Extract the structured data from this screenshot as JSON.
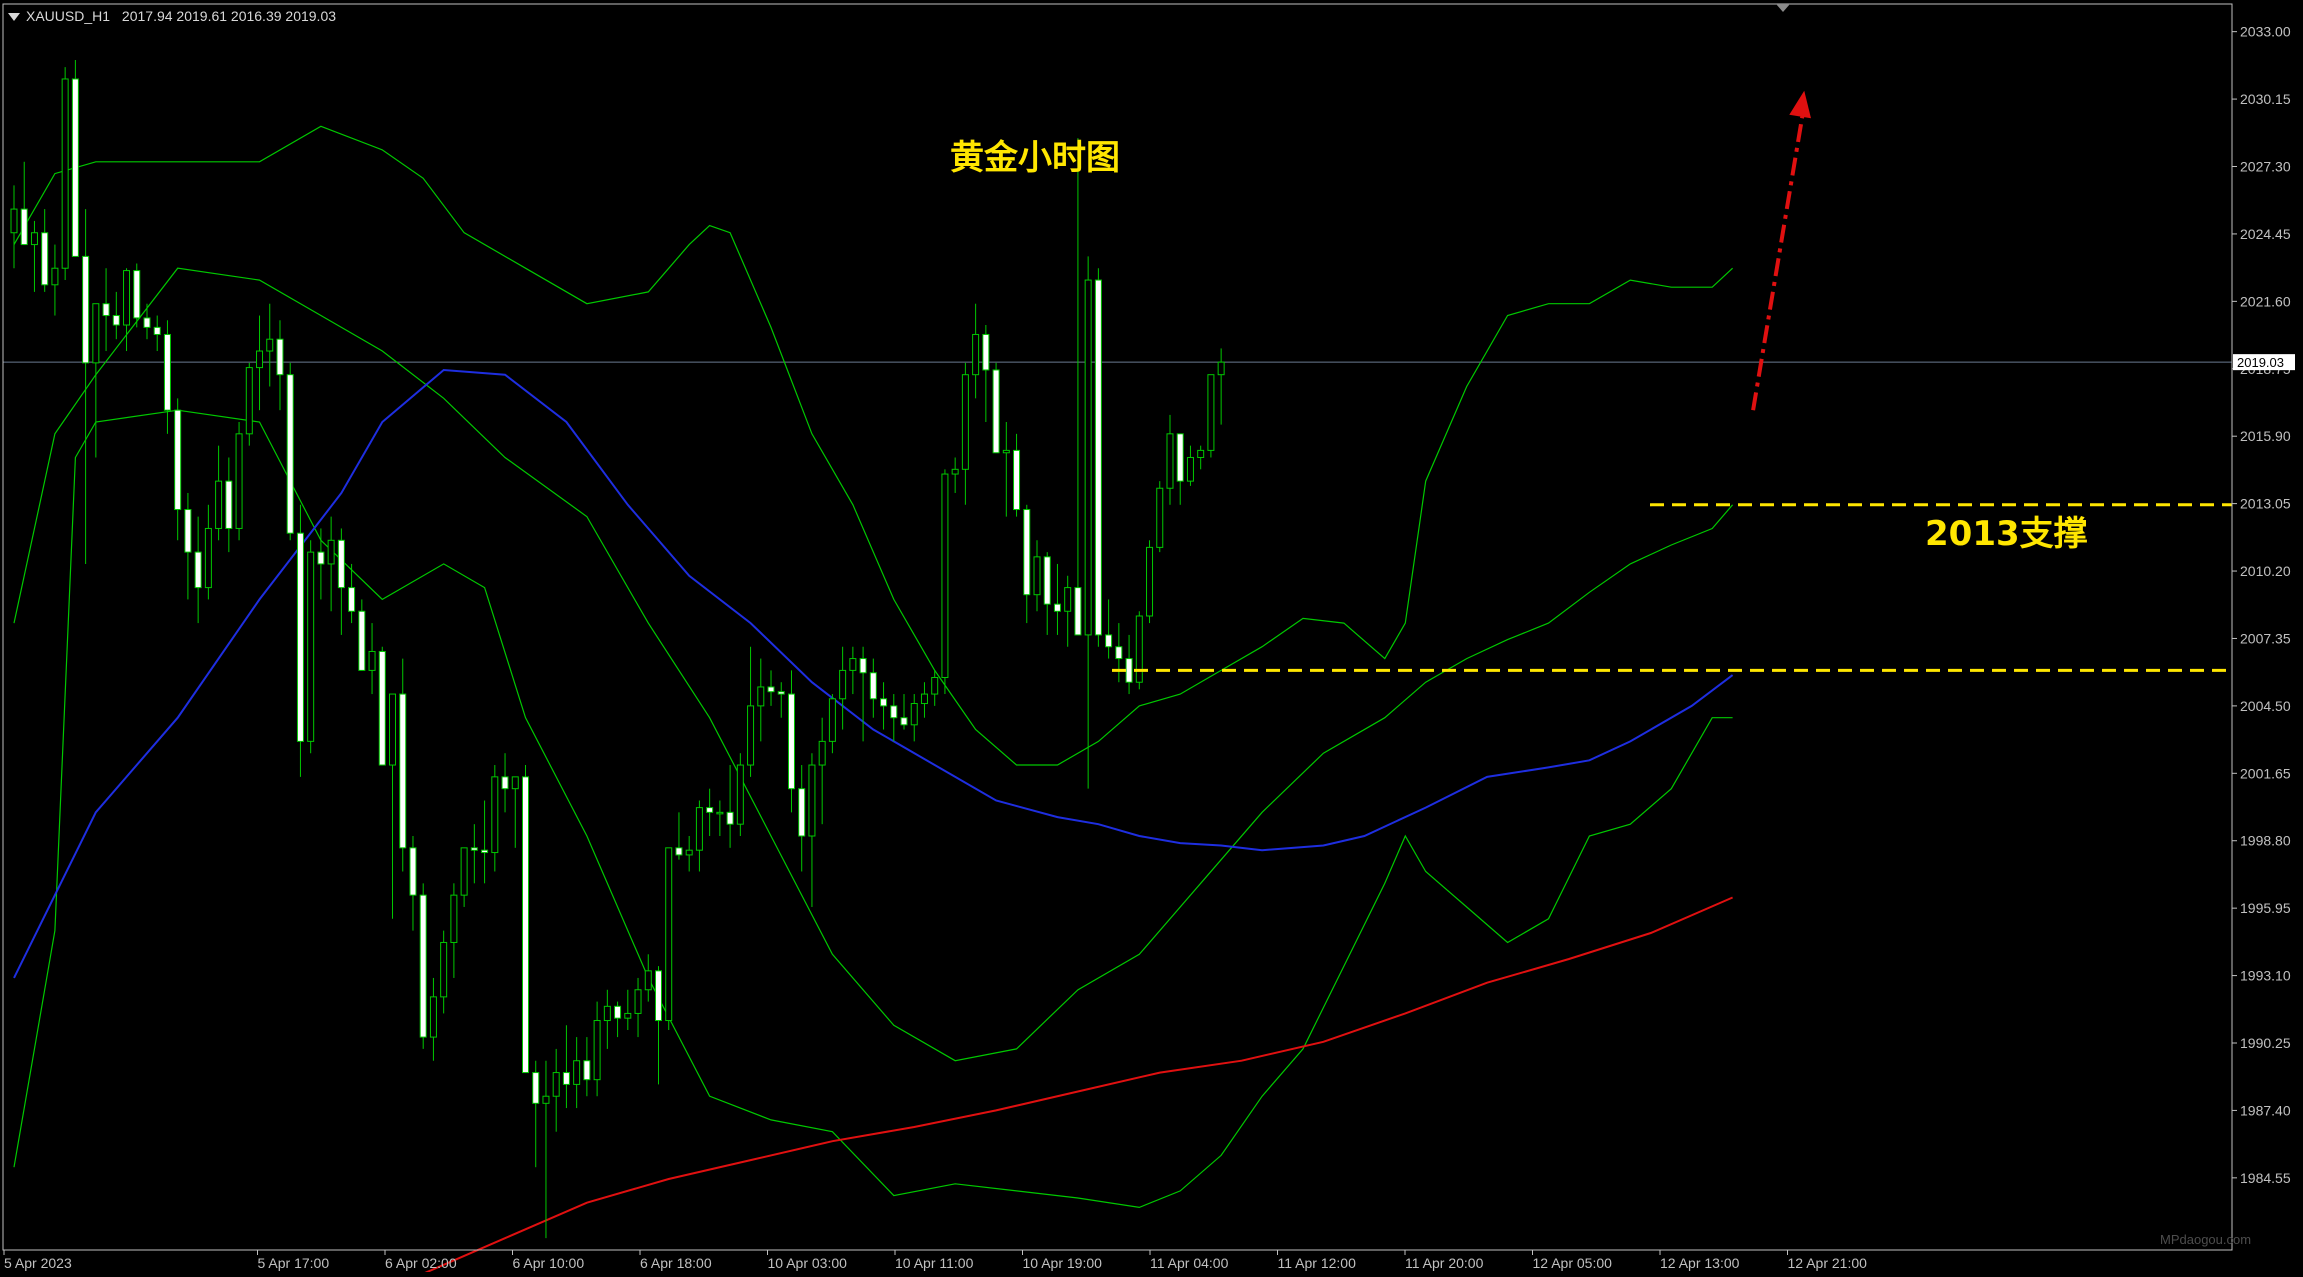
{
  "header": {
    "symbol": "XAUUSD_H1",
    "ohlc": "2017.94 2019.61 2016.39 2019.03"
  },
  "annotations": {
    "title": "黄金小时图",
    "support_label": "2013支撑"
  },
  "watermark": "MPdaogou.com",
  "colors": {
    "background": "#000000",
    "axis": "#c0c0c0",
    "candle_body": "#ffffff",
    "wick": "#00c800",
    "bollinger": "#00c800",
    "ma_blue": "#1e2ee0",
    "ma_red": "#e01010",
    "support_line": "#ffe600",
    "arrow": "#e01010",
    "title_text": "#ffe600"
  },
  "chart_data": {
    "type": "candlestick",
    "timeframe": "H1",
    "y_range": [
      1981.5,
      2034.0
    ],
    "y_ticks": [
      2033.0,
      2030.15,
      2027.3,
      2024.45,
      2021.6,
      2018.75,
      2015.9,
      2013.05,
      2010.2,
      2007.35,
      2004.5,
      2001.65,
      1998.8,
      1995.95,
      1993.1,
      1990.25,
      1987.4,
      1984.55
    ],
    "current_price": 2019.03,
    "x_labels": [
      "5 Apr 2023",
      "5 Apr 17:00",
      "6 Apr 02:00",
      "6 Apr 10:00",
      "6 Apr 18:00",
      "10 Apr 03:00",
      "10 Apr 11:00",
      "10 Apr 19:00",
      "11 Apr 04:00",
      "11 Apr 12:00",
      "11 Apr 20:00",
      "12 Apr 05:00",
      "12 Apr 13:00",
      "12 Apr 21:00"
    ],
    "candles_ohlc": [
      [
        2024.5,
        2026.5,
        2023.0,
        2025.5
      ],
      [
        2025.5,
        2027.5,
        2024.0,
        2024.0
      ],
      [
        2024.0,
        2025.0,
        2022.0,
        2024.5
      ],
      [
        2024.5,
        2025.5,
        2022.0,
        2022.3
      ],
      [
        2022.3,
        2024.0,
        2021.0,
        2023.0
      ],
      [
        2023.0,
        2031.5,
        2022.5,
        2031.0
      ],
      [
        2031.0,
        2031.8,
        2023.5,
        2023.5
      ],
      [
        2023.5,
        2025.5,
        2010.5,
        2019.0
      ],
      [
        2019.0,
        2021.5,
        2015.0,
        2021.5
      ],
      [
        2021.5,
        2023.0,
        2019.5,
        2021.0
      ],
      [
        2021.0,
        2022.0,
        2020.0,
        2020.6
      ],
      [
        2020.6,
        2023.0,
        2019.5,
        2022.9
      ],
      [
        2022.9,
        2023.2,
        2020.5,
        2020.9
      ],
      [
        2020.9,
        2021.5,
        2020.0,
        2020.5
      ],
      [
        2020.5,
        2021.0,
        2019.5,
        2020.2
      ],
      [
        2020.2,
        2020.8,
        2016.0,
        2017.0
      ],
      [
        2017.0,
        2017.5,
        2011.5,
        2012.8
      ],
      [
        2012.8,
        2013.5,
        2009.0,
        2011.0
      ],
      [
        2011.0,
        2012.5,
        2008.0,
        2009.5
      ],
      [
        2009.5,
        2013.0,
        2009.0,
        2012.0
      ],
      [
        2012.0,
        2015.5,
        2011.5,
        2014.0
      ],
      [
        2014.0,
        2015.0,
        2011.0,
        2012.0
      ],
      [
        2012.0,
        2016.5,
        2011.5,
        2016.0
      ],
      [
        2016.0,
        2019.0,
        2015.5,
        2018.8
      ],
      [
        2018.8,
        2021.0,
        2017.0,
        2019.5
      ],
      [
        2019.5,
        2021.5,
        2018.0,
        2020.0
      ],
      [
        2020.0,
        2020.8,
        2017.0,
        2018.5
      ],
      [
        2018.5,
        2019.0,
        2011.5,
        2011.8
      ],
      [
        2011.8,
        2013.0,
        2001.5,
        2003.0
      ],
      [
        2003.0,
        2011.5,
        2002.5,
        2011.0
      ],
      [
        2011.0,
        2012.0,
        2009.0,
        2010.5
      ],
      [
        2010.5,
        2012.5,
        2008.5,
        2011.5
      ],
      [
        2011.5,
        2012.0,
        2007.5,
        2009.5
      ],
      [
        2009.5,
        2010.5,
        2008.0,
        2008.5
      ],
      [
        2008.5,
        2009.0,
        2006.0,
        2006.0
      ],
      [
        2006.0,
        2008.0,
        2005.0,
        2006.8
      ],
      [
        2006.8,
        2007.0,
        2002.0,
        2002.0
      ],
      [
        2002.0,
        2005.0,
        1995.5,
        2005.0
      ],
      [
        2005.0,
        2006.5,
        1997.5,
        1998.5
      ],
      [
        1998.5,
        1999.0,
        1995.0,
        1996.5
      ],
      [
        1996.5,
        1997.0,
        1990.0,
        1990.5
      ],
      [
        1990.5,
        1993.0,
        1989.5,
        1992.2
      ],
      [
        1992.2,
        1995.0,
        1991.5,
        1994.5
      ],
      [
        1994.5,
        1997.0,
        1993.0,
        1996.5
      ],
      [
        1996.5,
        1998.5,
        1996.0,
        1998.5
      ],
      [
        1998.5,
        1999.5,
        1997.0,
        1998.4
      ],
      [
        1998.4,
        2000.5,
        1997.0,
        1998.3
      ],
      [
        1998.3,
        2002.0,
        1997.5,
        2001.5
      ],
      [
        2001.5,
        2002.5,
        2000.0,
        2001.0
      ],
      [
        2001.0,
        2001.5,
        1998.5,
        2001.5
      ],
      [
        2001.5,
        2002.0,
        1989.0,
        1989.0
      ],
      [
        1989.0,
        1989.5,
        1985.0,
        1987.7
      ],
      [
        1987.7,
        1989.5,
        1982.0,
        1988.0
      ],
      [
        1988.0,
        1990.0,
        1986.5,
        1989.0
      ],
      [
        1989.0,
        1991.0,
        1987.5,
        1988.5
      ],
      [
        1988.5,
        1990.5,
        1987.5,
        1989.5
      ],
      [
        1989.5,
        1990.5,
        1988.0,
        1988.7
      ],
      [
        1988.7,
        1992.0,
        1988.0,
        1991.2
      ],
      [
        1991.2,
        1992.5,
        1990.0,
        1991.8
      ],
      [
        1991.8,
        1992.0,
        1990.5,
        1991.3
      ],
      [
        1991.3,
        1992.5,
        1990.8,
        1991.5
      ],
      [
        1991.5,
        1993.0,
        1990.5,
        1992.5
      ],
      [
        1992.5,
        1994.0,
        1992.0,
        1993.3
      ],
      [
        1993.3,
        1993.5,
        1988.5,
        1991.2
      ],
      [
        1991.2,
        1998.5,
        1990.8,
        1998.5
      ],
      [
        1998.5,
        2000.0,
        1998.0,
        1998.2
      ],
      [
        1998.2,
        1999.0,
        1997.5,
        1998.4
      ],
      [
        1998.4,
        2000.5,
        1997.5,
        2000.2
      ],
      [
        2000.2,
        2001.0,
        1999.0,
        2000.0
      ],
      [
        2000.0,
        2000.5,
        1999.0,
        2000.0
      ],
      [
        2000.0,
        2002.0,
        1998.5,
        1999.5
      ],
      [
        1999.5,
        2002.5,
        1999.0,
        2002.0
      ],
      [
        2002.0,
        2007.0,
        2001.5,
        2004.5
      ],
      [
        2004.5,
        2006.5,
        2003.0,
        2005.3
      ],
      [
        2005.3,
        2006.0,
        2004.5,
        2005.1
      ],
      [
        2005.1,
        2005.5,
        2004.0,
        2005.0
      ],
      [
        2005.0,
        2006.0,
        2000.0,
        2001.0
      ],
      [
        2001.0,
        2002.0,
        1997.5,
        1999.0
      ],
      [
        1999.0,
        2002.5,
        1996.0,
        2002.0
      ],
      [
        2002.0,
        2004.0,
        1999.5,
        2003.0
      ],
      [
        2003.0,
        2005.0,
        2002.5,
        2004.8
      ],
      [
        2004.8,
        2007.0,
        2003.5,
        2006.0
      ],
      [
        2006.0,
        2007.0,
        2005.0,
        2006.5
      ],
      [
        2006.5,
        2007.0,
        2003.0,
        2005.9
      ],
      [
        2005.9,
        2006.5,
        2004.0,
        2004.8
      ],
      [
        2004.8,
        2005.5,
        2003.5,
        2004.5
      ],
      [
        2004.5,
        2005.0,
        2003.0,
        2004.0
      ],
      [
        2004.0,
        2005.0,
        2003.5,
        2003.7
      ],
      [
        2003.7,
        2005.0,
        2003.0,
        2004.6
      ],
      [
        2004.6,
        2005.5,
        2004.0,
        2005.0
      ],
      [
        2005.0,
        2006.0,
        2004.5,
        2005.7
      ],
      [
        2005.7,
        2014.5,
        2005.0,
        2014.3
      ],
      [
        2014.3,
        2015.0,
        2013.5,
        2014.5
      ],
      [
        2014.5,
        2019.0,
        2013.0,
        2018.5
      ],
      [
        2018.5,
        2021.5,
        2017.5,
        2020.2
      ],
      [
        2020.2,
        2020.6,
        2016.5,
        2018.7
      ],
      [
        2018.7,
        2019.0,
        2016.0,
        2015.2
      ],
      [
        2015.2,
        2016.5,
        2012.5,
        2015.3
      ],
      [
        2015.3,
        2016.0,
        2012.5,
        2012.8
      ],
      [
        2012.8,
        2013.0,
        2008.0,
        2009.2
      ],
      [
        2009.2,
        2011.5,
        2008.5,
        2010.8
      ],
      [
        2010.8,
        2011.0,
        2007.5,
        2008.8
      ],
      [
        2008.8,
        2010.5,
        2007.5,
        2008.5
      ],
      [
        2008.5,
        2010.0,
        2007.0,
        2009.5
      ],
      [
        2009.5,
        2028.5,
        2007.5,
        2007.5
      ],
      [
        2007.5,
        2023.5,
        2001.0,
        2022.5
      ],
      [
        2022.5,
        2023.0,
        2007.0,
        2007.5
      ],
      [
        2007.5,
        2009.0,
        2006.5,
        2007.0
      ],
      [
        2007.0,
        2008.0,
        2005.5,
        2006.5
      ],
      [
        2006.5,
        2007.5,
        2005.0,
        2005.5
      ],
      [
        2005.5,
        2008.5,
        2005.2,
        2008.3
      ],
      [
        2008.3,
        2011.5,
        2008.0,
        2011.2
      ],
      [
        2011.2,
        2014.0,
        2011.0,
        2013.7
      ],
      [
        2013.7,
        2016.8,
        2013.0,
        2016.0
      ],
      [
        2016.0,
        2016.0,
        2013.0,
        2014.0
      ],
      [
        2014.0,
        2015.5,
        2013.8,
        2015.0
      ],
      [
        2015.0,
        2015.5,
        2014.5,
        2015.3
      ],
      [
        2015.3,
        2018.5,
        2015.0,
        2018.5
      ],
      [
        2018.5,
        2019.61,
        2016.39,
        2019.03
      ]
    ],
    "ma_blue": [
      [
        0,
        1993.0
      ],
      [
        8,
        2000.0
      ],
      [
        16,
        2004.0
      ],
      [
        24,
        2009.0
      ],
      [
        32,
        2013.5
      ],
      [
        36,
        2016.5
      ],
      [
        42,
        2018.7
      ],
      [
        48,
        2018.5
      ],
      [
        54,
        2016.5
      ],
      [
        60,
        2013.0
      ],
      [
        66,
        2010.0
      ],
      [
        72,
        2008.0
      ],
      [
        78,
        2005.5
      ],
      [
        84,
        2003.5
      ],
      [
        90,
        2002.0
      ],
      [
        96,
        2000.5
      ],
      [
        102,
        1999.8
      ],
      [
        106,
        1999.5
      ],
      [
        110,
        1999.0
      ],
      [
        114,
        1998.7
      ],
      [
        118,
        1998.6
      ],
      [
        122,
        1998.4
      ],
      [
        128,
        1998.6
      ],
      [
        132,
        1999.0
      ],
      [
        138,
        2000.2
      ],
      [
        144,
        2001.5
      ],
      [
        150,
        2001.9
      ],
      [
        154,
        2002.2
      ],
      [
        158,
        2003.0
      ],
      [
        164,
        2004.5
      ],
      [
        168,
        2005.8
      ]
    ],
    "ma_red": [
      [
        40,
        1980.5
      ],
      [
        48,
        1982.0
      ],
      [
        56,
        1983.5
      ],
      [
        64,
        1984.5
      ],
      [
        72,
        1985.3
      ],
      [
        80,
        1986.1
      ],
      [
        88,
        1986.7
      ],
      [
        96,
        1987.4
      ],
      [
        104,
        1988.2
      ],
      [
        112,
        1989.0
      ],
      [
        120,
        1989.5
      ],
      [
        128,
        1990.3
      ],
      [
        136,
        1991.5
      ],
      [
        144,
        1992.8
      ],
      [
        152,
        1993.8
      ],
      [
        160,
        1994.9
      ],
      [
        168,
        1996.4
      ]
    ],
    "bb_upper": [
      [
        0,
        2024.0
      ],
      [
        4,
        2027.0
      ],
      [
        8,
        2027.5
      ],
      [
        16,
        2027.5
      ],
      [
        24,
        2027.5
      ],
      [
        30,
        2029.0
      ],
      [
        36,
        2028.0
      ],
      [
        40,
        2026.8
      ],
      [
        44,
        2024.5
      ],
      [
        50,
        2023.0
      ],
      [
        56,
        2021.5
      ],
      [
        62,
        2022.0
      ],
      [
        66,
        2024.0
      ],
      [
        68,
        2024.8
      ],
      [
        70,
        2024.5
      ],
      [
        74,
        2020.5
      ],
      [
        78,
        2016.0
      ],
      [
        82,
        2013.0
      ],
      [
        86,
        2009.0
      ],
      [
        90,
        2006.0
      ],
      [
        94,
        2003.5
      ],
      [
        98,
        2002.0
      ],
      [
        102,
        2002.0
      ],
      [
        106,
        2003.0
      ],
      [
        110,
        2004.5
      ],
      [
        114,
        2005.0
      ],
      [
        118,
        2006.0
      ],
      [
        122,
        2007.0
      ],
      [
        126,
        2008.2
      ],
      [
        130,
        2008.0
      ],
      [
        134,
        2006.5
      ],
      [
        136,
        2008.0
      ],
      [
        138,
        2014.0
      ],
      [
        142,
        2018.0
      ],
      [
        146,
        2021.0
      ],
      [
        150,
        2021.5
      ],
      [
        154,
        2021.5
      ],
      [
        158,
        2022.5
      ],
      [
        162,
        2022.2
      ],
      [
        166,
        2022.2
      ],
      [
        168,
        2023.0
      ]
    ],
    "bb_middle": [
      [
        0,
        2008.0
      ],
      [
        4,
        2016.0
      ],
      [
        8,
        2018.5
      ],
      [
        16,
        2023.0
      ],
      [
        24,
        2022.5
      ],
      [
        30,
        2021.0
      ],
      [
        36,
        2019.5
      ],
      [
        42,
        2017.5
      ],
      [
        48,
        2015.0
      ],
      [
        56,
        2012.5
      ],
      [
        62,
        2008.0
      ],
      [
        68,
        2004.0
      ],
      [
        74,
        1999.0
      ],
      [
        80,
        1994.0
      ],
      [
        86,
        1991.0
      ],
      [
        92,
        1989.5
      ],
      [
        98,
        1990.0
      ],
      [
        104,
        1992.5
      ],
      [
        110,
        1994.0
      ],
      [
        116,
        1997.0
      ],
      [
        122,
        2000.0
      ],
      [
        128,
        2002.5
      ],
      [
        134,
        2004.0
      ],
      [
        138,
        2005.5
      ],
      [
        142,
        2006.5
      ],
      [
        146,
        2007.3
      ],
      [
        150,
        2008.0
      ],
      [
        154,
        2009.3
      ],
      [
        158,
        2010.5
      ],
      [
        162,
        2011.3
      ],
      [
        166,
        2012.0
      ],
      [
        168,
        2013.0
      ]
    ],
    "bb_lower": [
      [
        0,
        1985.0
      ],
      [
        4,
        1995.0
      ],
      [
        6,
        2015.0
      ],
      [
        8,
        2016.5
      ],
      [
        16,
        2017.0
      ],
      [
        24,
        2016.5
      ],
      [
        30,
        2011.5
      ],
      [
        36,
        2009.0
      ],
      [
        42,
        2010.5
      ],
      [
        46,
        2009.5
      ],
      [
        50,
        2004.0
      ],
      [
        56,
        1999.0
      ],
      [
        62,
        1993.0
      ],
      [
        68,
        1988.0
      ],
      [
        74,
        1987.0
      ],
      [
        80,
        1986.5
      ],
      [
        86,
        1983.8
      ],
      [
        92,
        1984.3
      ],
      [
        98,
        1984.0
      ],
      [
        104,
        1983.7
      ],
      [
        110,
        1983.3
      ],
      [
        114,
        1984.0
      ],
      [
        118,
        1985.5
      ],
      [
        122,
        1988.0
      ],
      [
        126,
        1990.0
      ],
      [
        130,
        1993.5
      ],
      [
        134,
        1997.0
      ],
      [
        136,
        1999.0
      ],
      [
        138,
        1997.5
      ],
      [
        142,
        1996.0
      ],
      [
        146,
        1994.5
      ],
      [
        150,
        1995.5
      ],
      [
        154,
        1999.0
      ],
      [
        158,
        1999.5
      ],
      [
        162,
        2001.0
      ],
      [
        166,
        2004.0
      ],
      [
        168,
        2004.0
      ]
    ],
    "support_levels": [
      2013.0,
      2006.0
    ],
    "trend_arrow": {
      "from": [
        170,
        2017.0
      ],
      "to": [
        175,
        2030.5
      ]
    }
  }
}
